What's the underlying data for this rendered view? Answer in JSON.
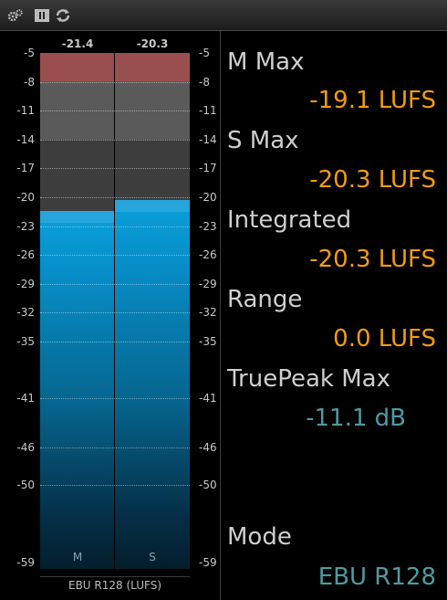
{
  "toolbar": {
    "icons": [
      "settings-icon",
      "pause-icon",
      "refresh-icon"
    ]
  },
  "meter": {
    "peaks": {
      "m": "-21.4",
      "s": "-20.3"
    },
    "levels": {
      "m": -21.4,
      "s": -20.3
    },
    "scale_ticks": [
      "-5",
      "-8",
      "-11",
      "-14",
      "-17",
      "-20",
      "-23",
      "-26",
      "-29",
      "-32",
      "-35",
      "-41",
      "-46",
      "-50",
      "-59"
    ],
    "channels": {
      "m": "M",
      "s": "S"
    },
    "scale_label": "EBU R128 (LUFS)"
  },
  "readouts": {
    "m_max": {
      "label": "M Max",
      "value": "-19.1 LUFS"
    },
    "s_max": {
      "label": "S Max",
      "value": "-20.3 LUFS"
    },
    "integrated": {
      "label": "Integrated",
      "value": "-20.3 LUFS"
    },
    "range": {
      "label": "Range",
      "value": "0.0 LUFS"
    },
    "truepeak_max": {
      "label": "TruePeak Max",
      "value": "-11.1 dB"
    },
    "mode": {
      "label": "Mode",
      "value": "EBU R128"
    }
  },
  "colors": {
    "value_orange": "#f39c12",
    "value_teal": "#4f9aa3",
    "meter_blue": "#0aa0dc",
    "meter_red": "#9a4f4f"
  }
}
